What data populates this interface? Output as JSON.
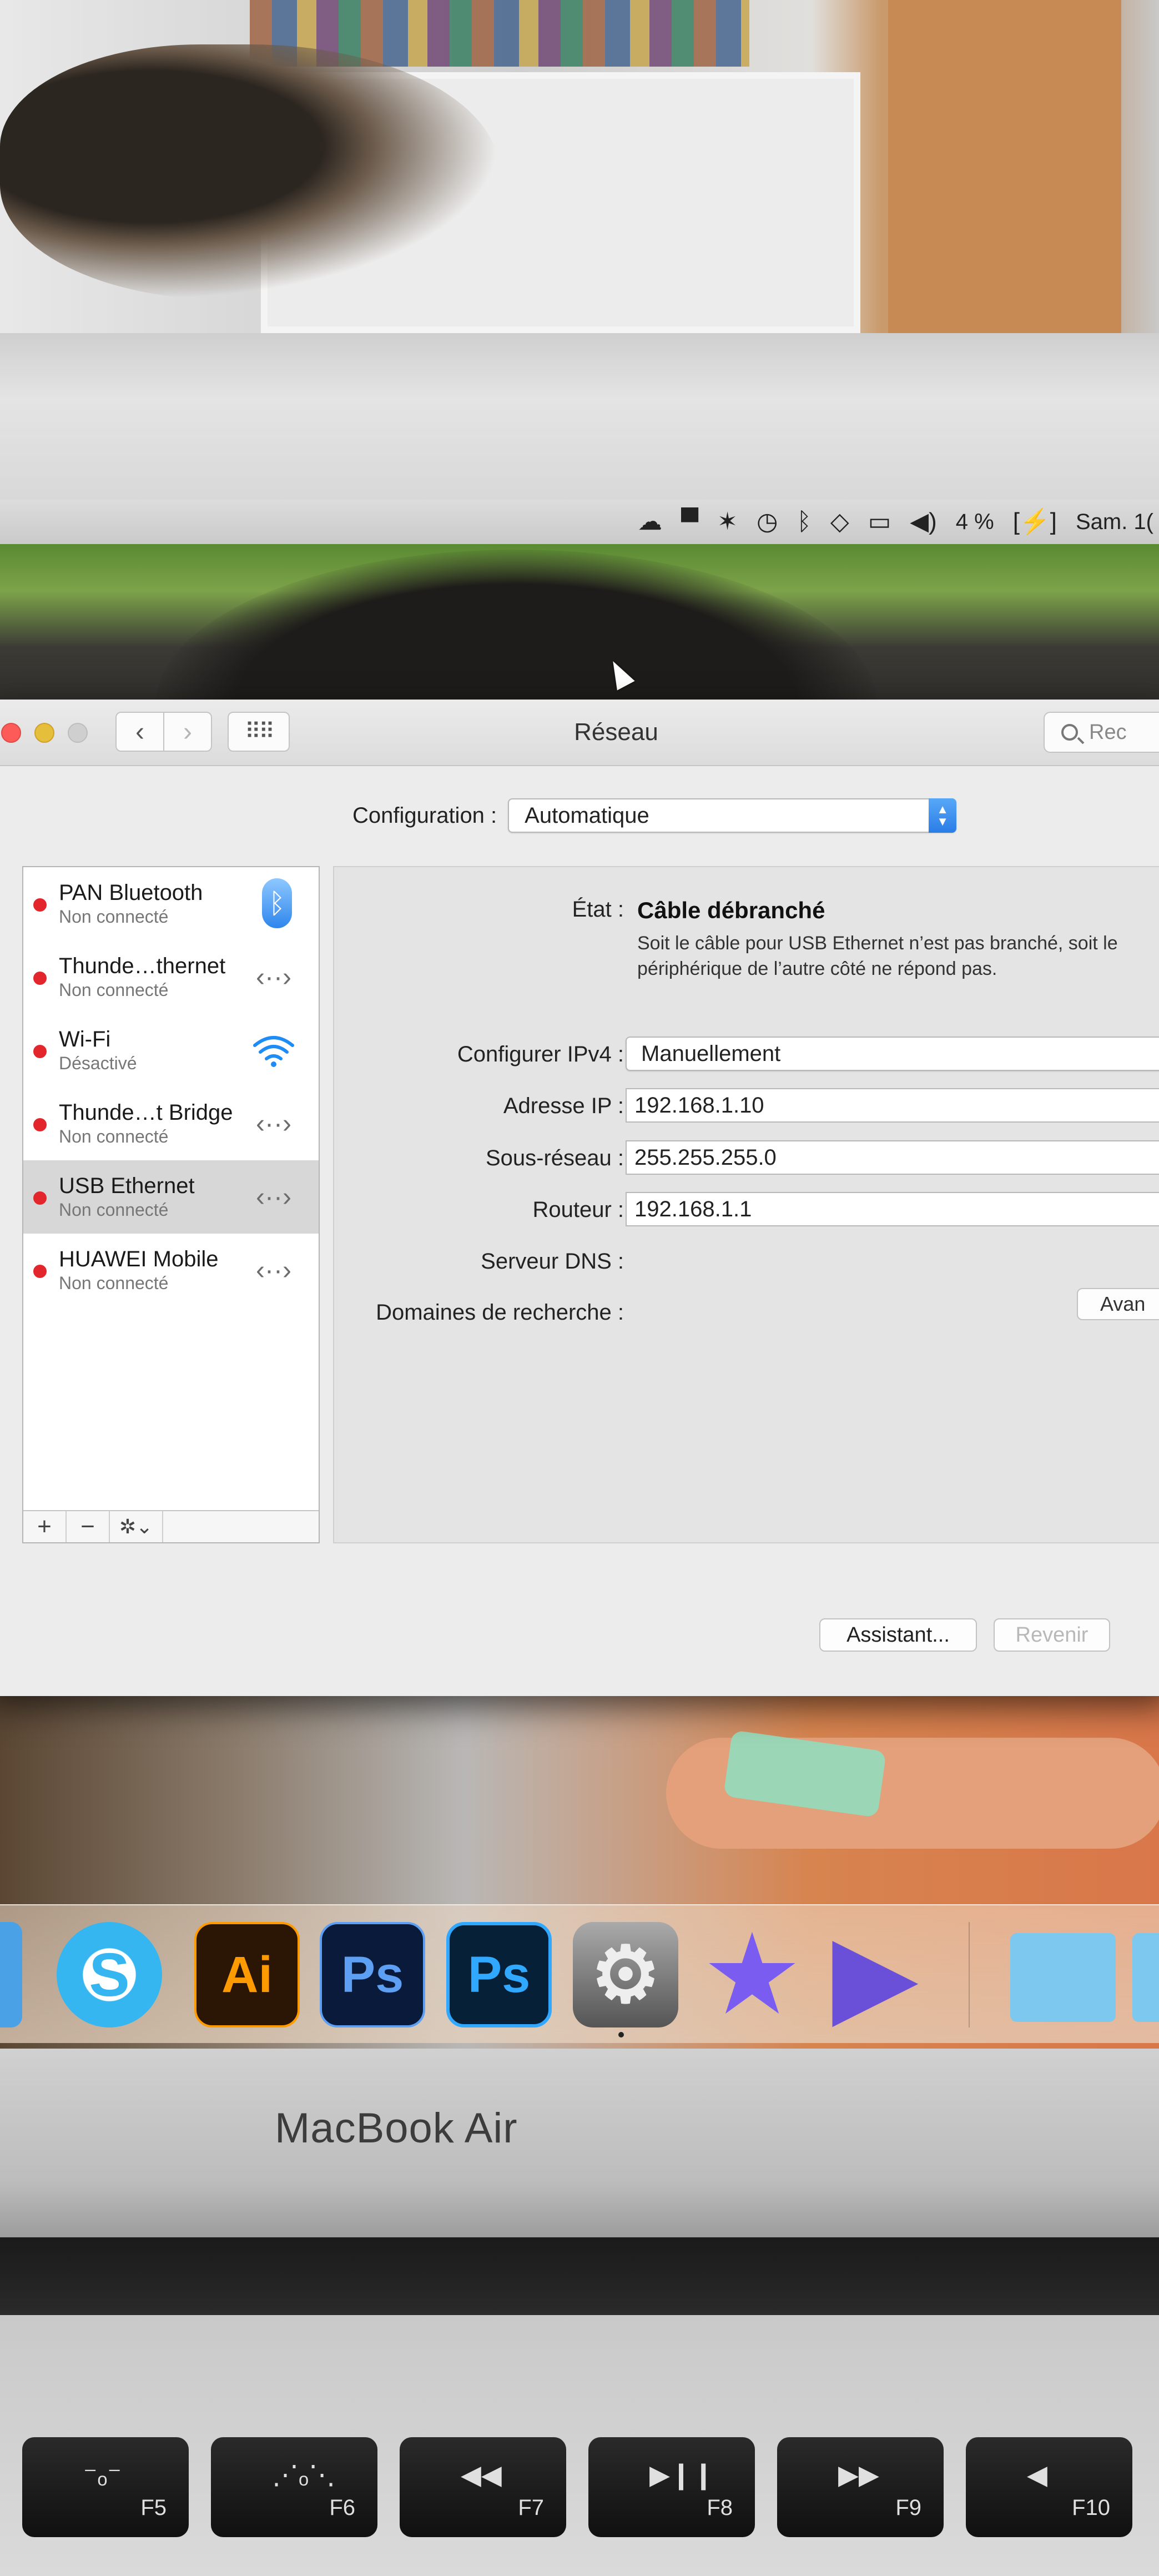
{
  "menubar": {
    "battery": "4 %",
    "date": "Sam. 1("
  },
  "window": {
    "title": "Réseau",
    "search_placeholder": "Rec",
    "configuration_label": "Configuration :",
    "configuration_value": "Automatique"
  },
  "services": [
    {
      "name": "PAN Bluetooth",
      "status": "Non connecté",
      "icon": "bluetooth-icon"
    },
    {
      "name": "Thunde…thernet",
      "status": "Non connecté",
      "icon": "ethernet-arrows-icon"
    },
    {
      "name": "Wi-Fi",
      "status": "Désactivé",
      "icon": "wifi-icon"
    },
    {
      "name": "Thunde…t Bridge",
      "status": "Non connecté",
      "icon": "ethernet-arrows-icon"
    },
    {
      "name": "USB Ethernet",
      "status": "Non connecté",
      "icon": "ethernet-arrows-icon"
    },
    {
      "name": "HUAWEI Mobile",
      "status": "Non connecté",
      "icon": "ethernet-arrows-icon"
    }
  ],
  "sidebar_footer": {
    "add": "+",
    "remove": "−",
    "gear": "✲⌄"
  },
  "details": {
    "state_label": "État :",
    "state_value": "Câble débranché",
    "state_description": "Soit le câble pour USB Ethernet n’est pas branché, soit le périphérique de l’autre côté ne répond pas.",
    "ipv4_label": "Configurer IPv4 :",
    "ipv4_value": "Manuellement",
    "ip_label": "Adresse IP :",
    "ip_value": "192.168.1.10",
    "subnet_label": "Sous-réseau :",
    "subnet_value": "255.255.255.0",
    "router_label": "Routeur :",
    "router_value": "192.168.1.1",
    "dns_label": "Serveur DNS :",
    "search_domains_label": "Domaines de recherche :",
    "advanced_button": "Avan"
  },
  "buttons": {
    "assistant": "Assistant...",
    "revert": "Revenir"
  },
  "dock": {
    "ai_label": "Ai",
    "ps_label": "Ps"
  },
  "hardware": {
    "brand": "MacBook Air",
    "keys": [
      "F5",
      "F6",
      "F7",
      "F8",
      "F9",
      "F10"
    ]
  }
}
